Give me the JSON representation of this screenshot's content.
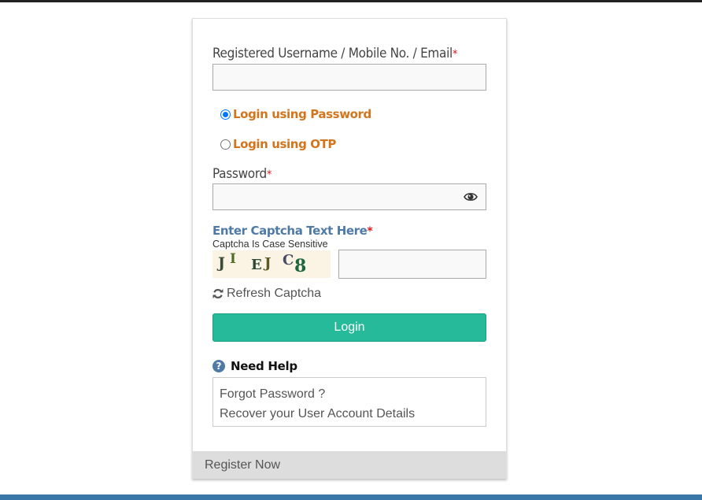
{
  "form": {
    "username": {
      "label": "Registered Username / Mobile No. / Email",
      "required_mark": "*",
      "value": ""
    },
    "login_mode": {
      "options": [
        {
          "label": "Login using Password",
          "selected": true
        },
        {
          "label": "Login using OTP",
          "selected": false
        }
      ]
    },
    "password": {
      "label": "Password",
      "required_mark": "*",
      "value": "",
      "toggle_icon": "eye-icon"
    },
    "captcha": {
      "label": "Enter Captcha Text Here",
      "required_mark": "*",
      "note": "Captcha Is Case Sensitive",
      "image_chars": [
        "J",
        "I",
        "E",
        "J",
        "C",
        "8"
      ],
      "value": "",
      "refresh_label": "Refresh Captcha",
      "refresh_icon": "refresh-icon"
    },
    "login_button": "Login",
    "help": {
      "title": "Need Help",
      "icon": "question-circle-icon",
      "links": [
        "Forgot Password ?",
        "Recover your User Account Details"
      ]
    },
    "register_label": "Register Now"
  },
  "colors": {
    "accent_orange": "#d2751d",
    "captcha_label_blue": "#4f7aa6",
    "login_green": "#26b99a",
    "required_red": "#e0161b",
    "footer_blue": "#3b76a8"
  }
}
